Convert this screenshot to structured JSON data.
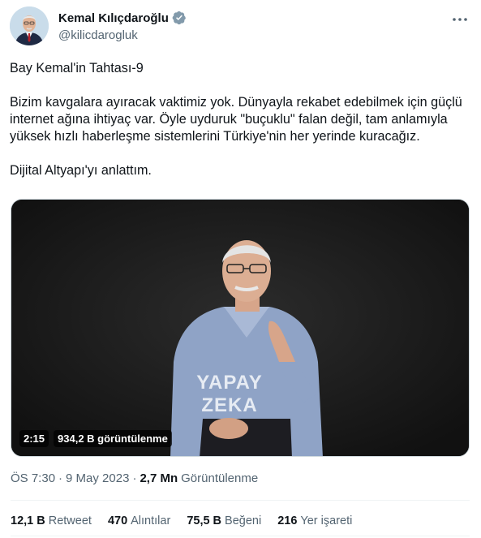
{
  "author": {
    "display_name": "Kemal Kılıçdaroğlu",
    "handle": "@kilicdarogluk",
    "verified": true
  },
  "tweet": {
    "title": "Bay Kemal'in Tahtası-9",
    "body": "Bizim kavgalara ayıracak vaktimiz yok. Dünyayla rekabet edebilmek için güçlü internet ağına ihtiyaç var. Öyle uyduruk \"buçuklu\" falan değil, tam anlamıyla yüksek hızlı haberleşme sistemlerini Türkiye'nin her yerinde kuracağız.",
    "closing": "Dijital Altyapı'yı anlattım."
  },
  "media": {
    "overlay_text": "YAPAY ZEKA",
    "duration": "2:15",
    "views": "934,2 B görüntülenme"
  },
  "meta": {
    "time": "ÖS 7:30",
    "separator": "·",
    "date": "9 May 2023",
    "views_count": "2,7 Mn",
    "views_label": "Görüntülenme"
  },
  "stats": [
    {
      "count": "12,1 B",
      "label": "Retweet"
    },
    {
      "count": "470",
      "label": "Alıntılar"
    },
    {
      "count": "75,5 B",
      "label": "Beğeni"
    },
    {
      "count": "216",
      "label": "Yer işareti"
    }
  ],
  "colors": {
    "text": "#0f1419",
    "secondary": "#536471",
    "verified_badge": "#829aab",
    "divider": "#eff3f4"
  },
  "icons": [
    "verified-badge-icon",
    "more-options-icon"
  ]
}
